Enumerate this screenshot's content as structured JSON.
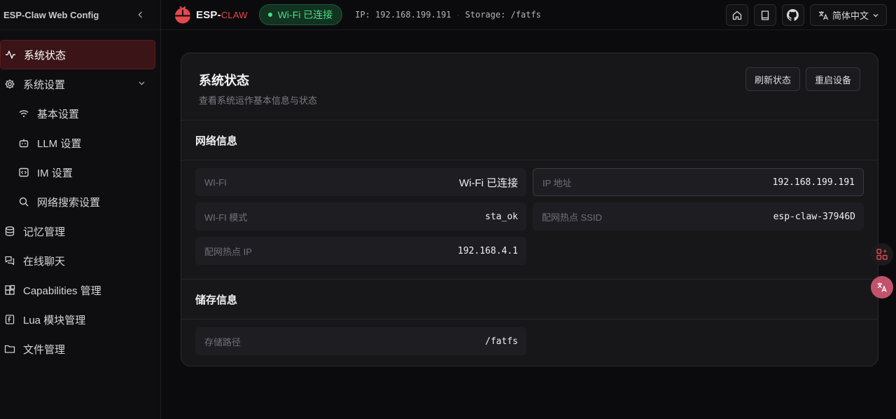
{
  "sidebar": {
    "title": "ESP-Claw Web Config",
    "collapse_icon": "chevron-left-icon",
    "items": [
      {
        "label": "系统状态",
        "icon": "activity-icon"
      },
      {
        "label": "系统设置",
        "icon": "gear-icon"
      },
      {
        "label": "基本设置",
        "icon": "wifi-icon"
      },
      {
        "label": "LLM 设置",
        "icon": "bot-icon"
      },
      {
        "label": "IM 设置",
        "icon": "message-code-icon"
      },
      {
        "label": "网络搜索设置",
        "icon": "search-icon"
      },
      {
        "label": "记忆管理",
        "icon": "database-icon"
      },
      {
        "label": "在线聊天",
        "icon": "chat-icon"
      },
      {
        "label": "Capabilities 管理",
        "icon": "blocks-icon"
      },
      {
        "label": "Lua 模块管理",
        "icon": "file-code-icon"
      },
      {
        "label": "文件管理",
        "icon": "folder-icon"
      }
    ]
  },
  "header": {
    "logo_main": "ESP-",
    "logo_accent": "CLAW",
    "wifi_status": "Wi-Fi 已连接",
    "ip": "IP: 192.168.199.191",
    "storage": "Storage: /fatfs",
    "language": "简体中文",
    "icons": [
      "home-icon",
      "book-icon",
      "github-icon",
      "translate-icon"
    ]
  },
  "card": {
    "title": "系统状态",
    "subtitle": "查看系统运作基本信息与状态",
    "refresh_label": "刷新状态",
    "reboot_label": "重启设备",
    "network": {
      "title": "网络信息",
      "fields": [
        {
          "label": "WI-FI",
          "value": "Wi-Fi 已连接"
        },
        {
          "label": "IP 地址",
          "value": "192.168.199.191"
        },
        {
          "label": "WI-FI 模式",
          "value": "sta_ok"
        },
        {
          "label": "配网热点 SSID",
          "value": "esp-claw-37946D"
        },
        {
          "label": "配网热点 IP",
          "value": "192.168.4.1"
        }
      ]
    },
    "storage": {
      "title": "储存信息",
      "fields": [
        {
          "label": "存储路径",
          "value": "/fatfs"
        }
      ]
    }
  },
  "colors": {
    "accent": "#e5484d",
    "success": "#4ade80",
    "active_bg": "#3a1416"
  }
}
